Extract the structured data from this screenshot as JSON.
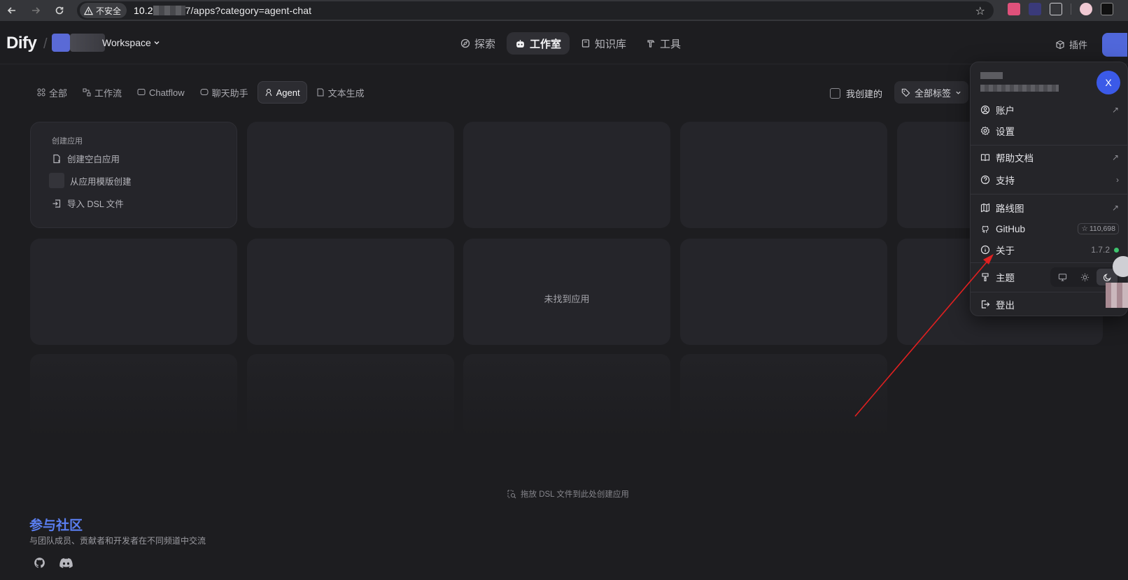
{
  "browser": {
    "security_label": "不安全",
    "url_prefix": "10.2",
    "url_suffix": "7/apps?category=agent-chat"
  },
  "header": {
    "logo": "Dify",
    "workspace_name": "Workspace",
    "nav": [
      {
        "label": "探索",
        "active": false
      },
      {
        "label": "工作室",
        "active": true
      },
      {
        "label": "知识库",
        "active": false
      },
      {
        "label": "工具",
        "active": false
      }
    ],
    "plugin_label": "插件"
  },
  "filters": {
    "items": [
      {
        "label": "全部"
      },
      {
        "label": "工作流"
      },
      {
        "label": "Chatflow"
      },
      {
        "label": "聊天助手"
      },
      {
        "label": "Agent"
      },
      {
        "label": "文本生成"
      }
    ],
    "active": "Agent",
    "mine_label": "我创建的",
    "tags_label": "全部标签"
  },
  "create_card": {
    "title": "创建应用",
    "blank": "创建空白应用",
    "template": "从应用模版创建",
    "import": "导入 DSL 文件"
  },
  "empty_state": "未找到应用",
  "drop_hint": "拖放 DSL 文件到此处创建应用",
  "community": {
    "title": "参与社区",
    "subtitle": "与团队成员、贡献者和开发者在不同频道中交流"
  },
  "user_menu": {
    "avatar_letter": "X",
    "account": "账户",
    "settings": "设置",
    "help_docs": "帮助文档",
    "support": "支持",
    "roadmap": "路线图",
    "github": "GitHub",
    "github_stars": "110,698",
    "about": "关于",
    "version": "1.7.2",
    "theme": "主题",
    "logout": "登出"
  },
  "colors": {
    "background": "#1d1d20",
    "accent": "#5a7ef0",
    "avatar": "#3b5ae8",
    "status_ok": "#3ec46d",
    "annotation_arrow": "#e02020"
  }
}
